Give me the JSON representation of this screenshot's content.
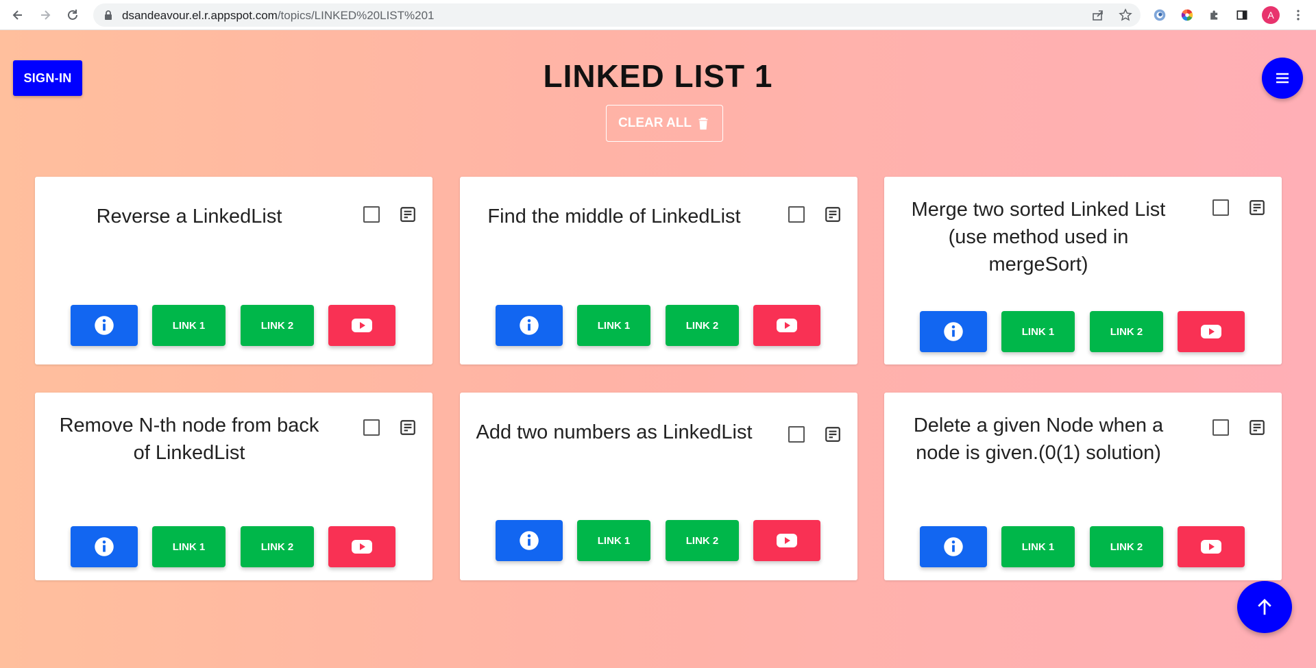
{
  "browser": {
    "url_host": "dsandeavour.el.r.appspot.com",
    "url_path": "/topics/LINKED%20LIST%201",
    "profile_initial": "A"
  },
  "header": {
    "signin_label": "SIGN-IN",
    "title": "LINKED LIST 1",
    "clear_all_label": "CLEAR ALL"
  },
  "cards": [
    {
      "title": "Reverse a LinkedList",
      "link1": "LINK 1",
      "link2": "LINK 2"
    },
    {
      "title": "Find the middle of LinkedList",
      "link1": "LINK 1",
      "link2": "LINK 2"
    },
    {
      "title": "Merge two sorted Linked List (use method used in mergeSort)",
      "link1": "LINK 1",
      "link2": "LINK 2"
    },
    {
      "title": "Remove N-th node from back of LinkedList",
      "link1": "LINK 1",
      "link2": "LINK 2"
    },
    {
      "title": "Add two numbers as LinkedList",
      "link1": "LINK 1",
      "link2": "LINK 2"
    },
    {
      "title": "Delete a given Node when a node is given.(0(1) solution)",
      "link1": "LINK 1",
      "link2": "LINK 2"
    }
  ],
  "colors": {
    "primary_blue": "#0000ff",
    "info": "#1266f1",
    "link": "#00b74a",
    "youtube": "#f93154"
  },
  "icons": [
    "back-icon",
    "forward-icon",
    "reload-icon",
    "lock-icon",
    "share-icon",
    "star-icon",
    "extension-icon",
    "puzzle-icon",
    "sidepanel-icon",
    "kebab-icon",
    "hamburger-icon",
    "trash-icon",
    "checkbox-icon",
    "note-icon",
    "info-icon",
    "youtube-icon",
    "arrow-up-icon"
  ]
}
